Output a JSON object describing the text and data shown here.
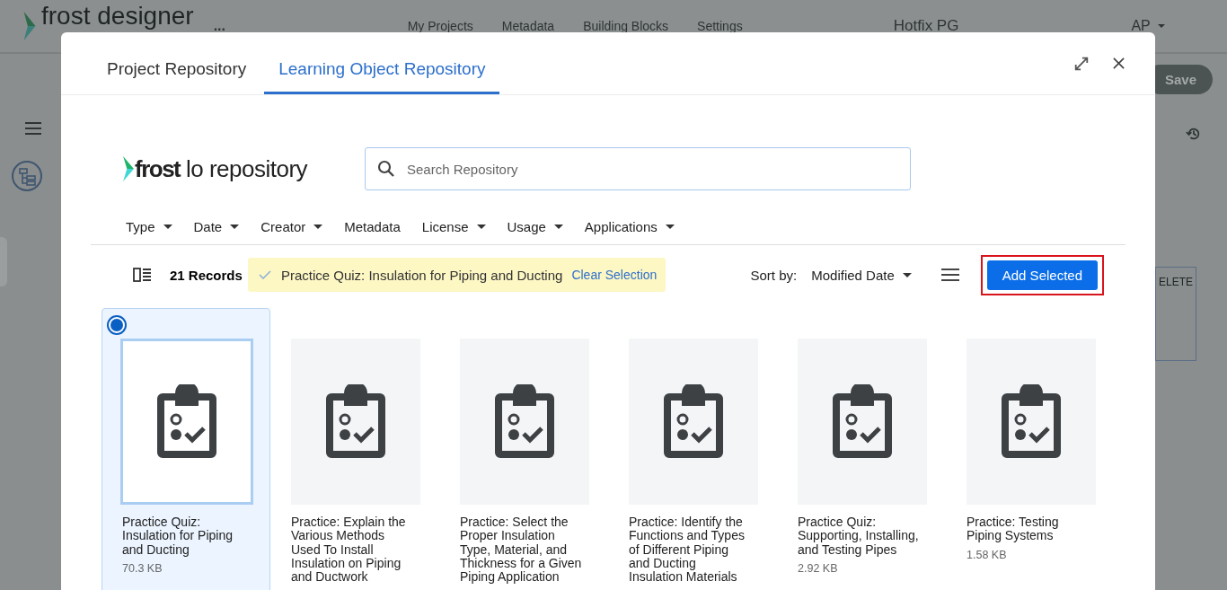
{
  "app_header": {
    "logo": "frost designer",
    "more": "...",
    "nav": [
      {
        "label": "My Projects"
      },
      {
        "label": "Metadata"
      },
      {
        "label": "Building Blocks"
      },
      {
        "label": "Settings"
      }
    ],
    "project": "Hotfix PG",
    "user": "AP"
  },
  "background": {
    "save_button": "Save",
    "delete_button": "ELETE"
  },
  "dialog": {
    "tabs": [
      {
        "label": "Project Repository",
        "selected": false
      },
      {
        "label": "Learning Object Repository",
        "selected": true
      }
    ],
    "logo": {
      "bold": "frost",
      "rest": "lo repository"
    },
    "search": {
      "placeholder": "Search Repository"
    },
    "filters": [
      {
        "label": "Type",
        "dropdown": true
      },
      {
        "label": "Date",
        "dropdown": true
      },
      {
        "label": "Creator",
        "dropdown": true
      },
      {
        "label": "Metadata",
        "dropdown": false
      },
      {
        "label": "License",
        "dropdown": true
      },
      {
        "label": "Usage",
        "dropdown": true
      },
      {
        "label": "Applications",
        "dropdown": true
      }
    ],
    "records": "21 Records",
    "selection": {
      "title": "Practice Quiz: Insulation for Piping and Ducting",
      "action": "Clear Selection"
    },
    "sort": {
      "label": "Sort by:",
      "value": "Modified Date"
    },
    "add_button": {
      "label": "Add Selected",
      "highlighted": true
    },
    "items": [
      {
        "title": "Practice Quiz: Insulation for Piping and Ducting",
        "size": "70.3 KB",
        "selected": true
      },
      {
        "title": "Practice: Explain the Various Methods Used To Install Insulation on Piping and Ductwork",
        "selected": false
      },
      {
        "title": "Practice: Select the Proper Insulation Type, Material, and Thickness for a Given Piping Application",
        "selected": false
      },
      {
        "title": "Practice: Identify the Functions and Types of Different Piping and Ducting Insulation Materials",
        "selected": false
      },
      {
        "title": "Practice Quiz: Supporting, Installing, and Testing Pipes",
        "size": "2.92 KB",
        "selected": false
      },
      {
        "title": "Practice: Testing Piping Systems",
        "size": "1.58 KB",
        "selected": false
      }
    ]
  }
}
